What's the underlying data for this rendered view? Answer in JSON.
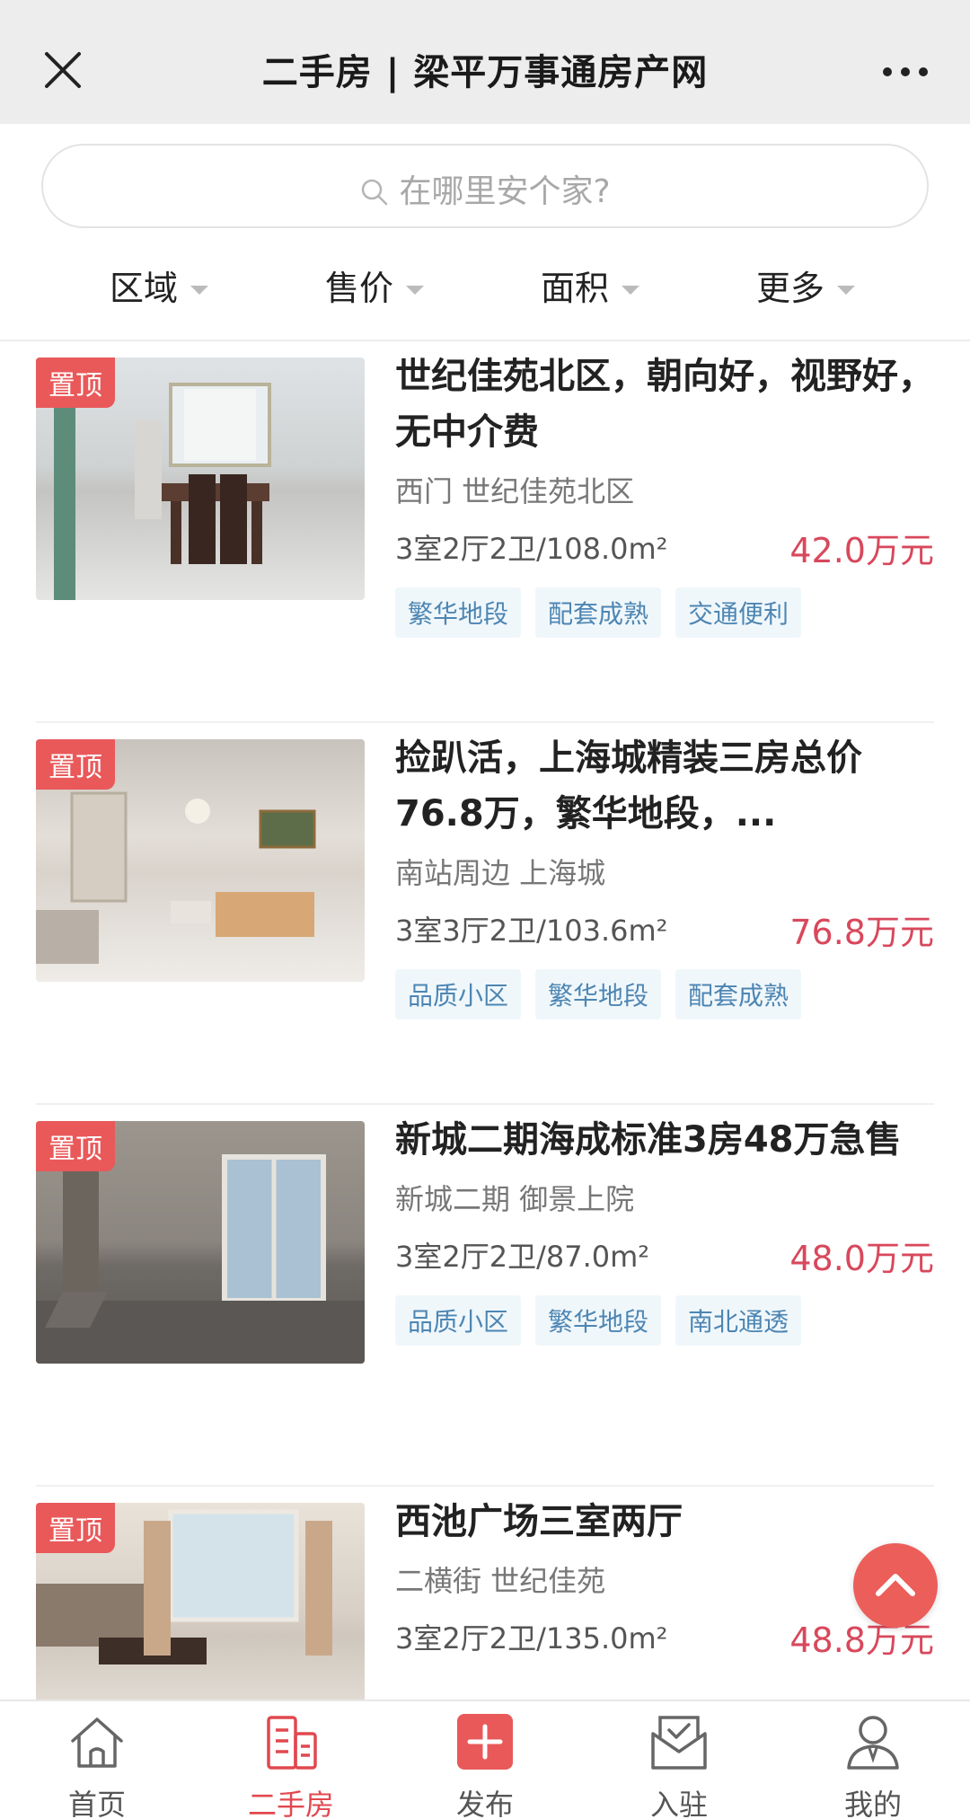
{
  "header": {
    "title": "二手房 | 梁平万事通房产网"
  },
  "search": {
    "placeholder": "在哪里安个家?"
  },
  "filters": [
    "区域",
    "售价",
    "面积",
    "更多"
  ],
  "listings": [
    {
      "badge": "置顶",
      "title": "世纪佳苑北区，朝向好，视野好，无中介费",
      "location": "西门 世纪佳苑北区",
      "spec": "3室2厅2卫/108.0m²",
      "price": "42.0万元",
      "tags": [
        "繁华地段",
        "配套成熟",
        "交通便利"
      ]
    },
    {
      "badge": "置顶",
      "title": "捡趴活，上海城精装三房总价76.8万，繁华地段，...",
      "location": "南站周边 上海城",
      "spec": "3室3厅2卫/103.6m²",
      "price": "76.8万元",
      "tags": [
        "品质小区",
        "繁华地段",
        "配套成熟"
      ]
    },
    {
      "badge": "置顶",
      "title": "新城二期海成标准3房48万急售",
      "location": "新城二期 御景上院",
      "spec": "3室2厅2卫/87.0m²",
      "price": "48.0万元",
      "tags": [
        "品质小区",
        "繁华地段",
        "南北通透"
      ]
    },
    {
      "badge": "置顶",
      "title": "西池广场三室两厅",
      "location": "二横街 世纪佳苑",
      "spec": "3室2厅2卫/135.0m²",
      "price": "48.8万元",
      "tags": []
    }
  ],
  "bottom_nav": [
    {
      "label": "首页",
      "icon": "home-icon",
      "active": false
    },
    {
      "label": "二手房",
      "icon": "building-icon",
      "active": true
    },
    {
      "label": "发布",
      "icon": "plus-icon",
      "active": false
    },
    {
      "label": "入驻",
      "icon": "mail-check-icon",
      "active": false
    },
    {
      "label": "我的",
      "icon": "person-icon",
      "active": false
    }
  ],
  "colors": {
    "accent": "#e1484f",
    "price": "#d8485c",
    "tag_text": "#4d86b3",
    "tag_bg": "#f0f7fb"
  }
}
